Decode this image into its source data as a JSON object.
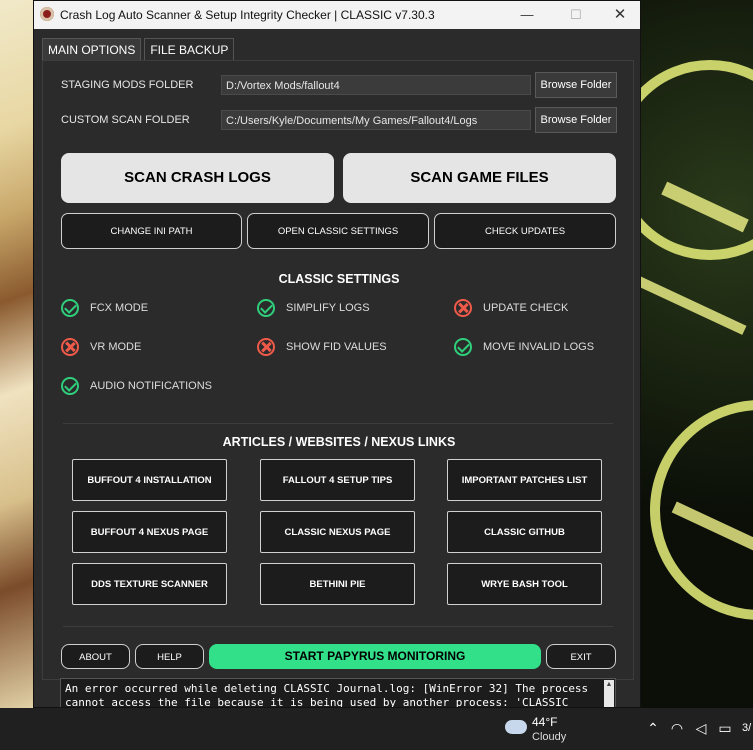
{
  "window": {
    "title": "Crash Log Auto Scanner & Setup Integrity Checker | CLASSIC v7.30.3",
    "controls": {
      "minimize": "—",
      "maximize": "☐",
      "close": "✕"
    }
  },
  "tabs": [
    {
      "label": "MAIN OPTIONS",
      "active": true
    },
    {
      "label": "FILE BACKUP",
      "active": false
    }
  ],
  "folders": {
    "staging": {
      "label": "STAGING MODS FOLDER",
      "value": "D:/Vortex Mods/fallout4",
      "button": "Browse Folder"
    },
    "custom": {
      "label": "CUSTOM SCAN FOLDER",
      "value": "C:/Users/Kyle/Documents/My Games/Fallout4/Logs",
      "button": "Browse Folder"
    }
  },
  "main_actions": {
    "scan_logs": "SCAN CRASH LOGS",
    "scan_game": "SCAN GAME FILES"
  },
  "secondary_actions": {
    "change_ini": "CHANGE INI PATH",
    "open_settings": "OPEN CLASSIC SETTINGS",
    "check_updates": "CHECK UPDATES"
  },
  "settings": {
    "title": "CLASSIC SETTINGS",
    "items": [
      {
        "label": "FCX MODE",
        "enabled": true,
        "icon": "check-circle-icon"
      },
      {
        "label": "SIMPLIFY LOGS",
        "enabled": true,
        "icon": "check-circle-icon"
      },
      {
        "label": "UPDATE CHECK",
        "enabled": false,
        "icon": "x-circle-icon"
      },
      {
        "label": "VR MODE",
        "enabled": false,
        "icon": "x-circle-icon"
      },
      {
        "label": "SHOW FID VALUES",
        "enabled": false,
        "icon": "x-circle-icon"
      },
      {
        "label": "MOVE INVALID LOGS",
        "enabled": true,
        "icon": "check-circle-icon"
      },
      {
        "label": "AUDIO NOTIFICATIONS",
        "enabled": true,
        "icon": "check-circle-icon"
      }
    ]
  },
  "links": {
    "title": "ARTICLES / WEBSITES / NEXUS LINKS",
    "buttons": [
      "BUFFOUT 4 INSTALLATION",
      "FALLOUT 4 SETUP TIPS",
      "IMPORTANT PATCHES LIST",
      "BUFFOUT 4 NEXUS PAGE",
      "CLASSIC NEXUS PAGE",
      "CLASSIC GITHUB",
      "DDS TEXTURE SCANNER",
      "BETHINI PIE",
      "WRYE BASH TOOL"
    ]
  },
  "bottom": {
    "about": "ABOUT",
    "help": "HELP",
    "papyrus": "START PAPYRUS MONITORING",
    "exit": "EXIT"
  },
  "output": {
    "text": "An error occurred while deleting CLASSIC Journal.log: [WinError 32] The process\ncannot access the file because it is being used by another process: 'CLASSIC"
  },
  "taskbar": {
    "temp": "44°F",
    "condition": "Cloudy",
    "clock": "3/"
  },
  "colors": {
    "accent_green": "#33e08a",
    "ok": "#2fcf7c",
    "bad": "#ef5a4a",
    "window_bg": "#2b2b2b"
  }
}
